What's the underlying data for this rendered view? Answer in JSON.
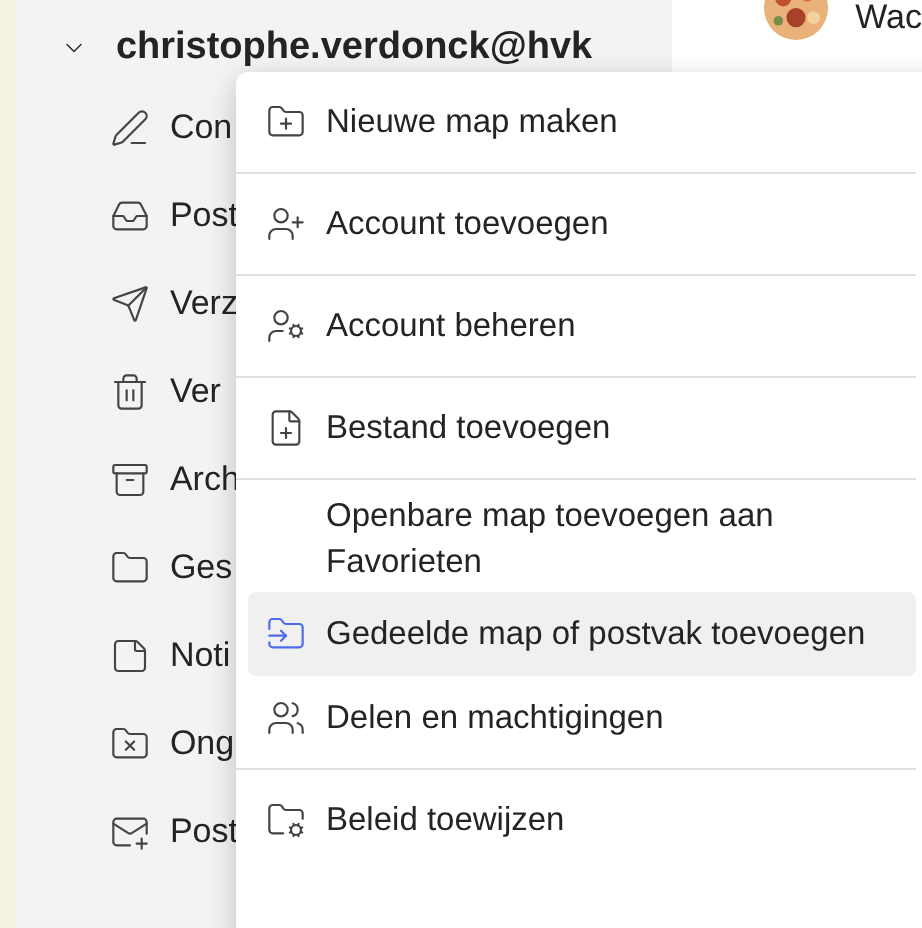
{
  "account": {
    "name": "christophe.verdonck@hvk",
    "expanded": true
  },
  "sidebar": {
    "items": [
      {
        "kind": "drafts",
        "label": "Con"
      },
      {
        "kind": "inbox",
        "label": "Post"
      },
      {
        "kind": "sent",
        "label": "Verz"
      },
      {
        "kind": "deleted",
        "label": "Ver"
      },
      {
        "kind": "archive",
        "label": "Arch"
      },
      {
        "kind": "folder",
        "label": "Ges"
      },
      {
        "kind": "notes",
        "label": "Noti"
      },
      {
        "kind": "junk",
        "label": "Ong"
      },
      {
        "kind": "outbox",
        "label": "Post"
      }
    ]
  },
  "message_preview": {
    "sender": "Wac"
  },
  "context_menu": {
    "groups": [
      [
        {
          "kind": "new-folder",
          "label": "Nieuwe map maken",
          "selected": false
        }
      ],
      [
        {
          "kind": "add-account",
          "label": "Account toevoegen",
          "selected": false
        }
      ],
      [
        {
          "kind": "manage-account",
          "label": "Account beheren",
          "selected": false
        }
      ],
      [
        {
          "kind": "add-file",
          "label": "Bestand toevoegen",
          "selected": false
        }
      ],
      [
        {
          "kind": "none",
          "label": "Openbare map toevoegen aan Favorieten",
          "selected": false
        },
        {
          "kind": "shared-folder",
          "label": "Gedeelde map of postvak toevoegen",
          "selected": true
        },
        {
          "kind": "sharing",
          "label": "Delen en machtigingen",
          "selected": false
        }
      ],
      [
        {
          "kind": "policy",
          "label": "Beleid toewijzen",
          "selected": false
        }
      ]
    ]
  }
}
